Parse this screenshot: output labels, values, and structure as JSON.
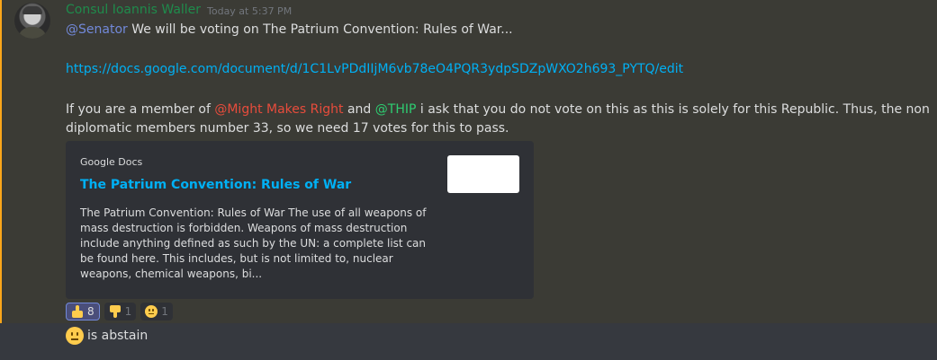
{
  "message": {
    "author": "Consul Ioannis Waller",
    "timestamp": "Today at 5:37 PM",
    "line1": {
      "mention": "@Senator",
      "text": " We will be voting on The Patrium Convention: Rules of War..."
    },
    "url": "https://docs.google.com/document/d/1C1LvPDdIIjM6vb78eO4PQR3ydpSDZpWXO2h693_PYTQ/edit",
    "line3": {
      "pre": "If you are a member of ",
      "mention1": "@Might Makes Right",
      "mid": " and ",
      "mention2": "@THIP",
      "post": " i ask that you do not vote on this as this is solely for this Republic. Thus, the non"
    },
    "line4": "diplomatic members number 33, so we need 17 votes for this to pass."
  },
  "embed": {
    "provider": "Google Docs",
    "title": "The Patrium Convention: Rules of War",
    "description": "The Patrium Convention: Rules of War The use of all weapons of mass destruction is forbidden. Weapons of mass destruction include anything defined as such by the UN: a complete list can be found here. This includes, but is not limited to, nuclear weapons, chemical weapons, bi..."
  },
  "reactions": [
    {
      "emoji": "thumbs-up",
      "count": "8"
    },
    {
      "emoji": "thumbs-down",
      "count": "1"
    },
    {
      "emoji": "neutral-face",
      "count": "1"
    }
  ],
  "message2": {
    "text": "is abstain"
  },
  "colors": {
    "author": "#1f8b4c",
    "mention_blue": "#7289da",
    "mention_red": "#e74c3c",
    "mention_green": "#2ecc71",
    "link": "#00b0f4",
    "highlight_bar": "#faa61a"
  }
}
